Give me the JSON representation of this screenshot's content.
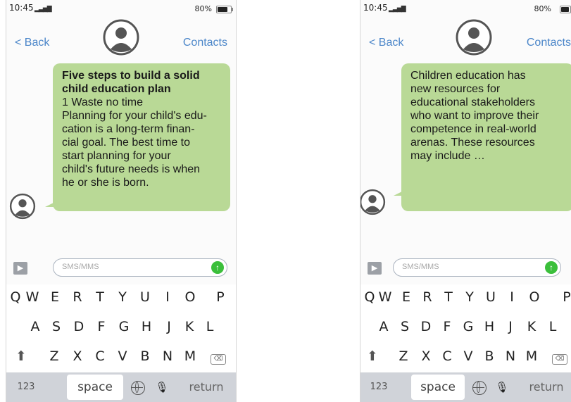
{
  "screens": [
    {
      "status": {
        "time": "10:45",
        "signal": "▂▃▅▇",
        "battery": "80%"
      },
      "nav": {
        "back": "< Back",
        "contacts": "Contacts"
      },
      "message": {
        "title": "Five steps to build a solid child education plan",
        "lines": [
          "1 Waste no time",
          "Planning for your child's edu-",
          "cation is a long-term finan-",
          "cial goal. The best time to",
          "start planning for your",
          "child's future needs is when",
          "he or she is born."
        ]
      },
      "input": {
        "placeholder": "SMS/MMS",
        "send_icon": "↑",
        "expand_icon": "▶"
      }
    },
    {
      "status": {
        "time": "10:45",
        "signal": "▂▃▅▇",
        "battery": "80%"
      },
      "nav": {
        "back": "< Back",
        "contacts": "Contacts"
      },
      "message": {
        "lines": [
          "Children education has",
          "new resources for",
          "educational stakeholders",
          "who want to improve their",
          "competence in real-world",
          "arenas. These resources",
          "may include …"
        ]
      },
      "input": {
        "placeholder": "SMS/MMS",
        "send_icon": "↑",
        "expand_icon": "▶"
      }
    }
  ],
  "keyboard": {
    "row1": [
      "Q",
      "W",
      "E",
      "R",
      "T",
      "Y",
      "U",
      "I",
      "O",
      "P"
    ],
    "row2": [
      "A",
      "S",
      "D",
      "F",
      "G",
      "H",
      "J",
      "K",
      "L"
    ],
    "row3": [
      "Z",
      "X",
      "C",
      "V",
      "B",
      "N",
      "M"
    ],
    "shift_icon": "⬆",
    "backspace_icon": "⌫",
    "numbers": "123",
    "space": "space",
    "return": "return",
    "mic_icon": "🎙"
  },
  "colors": {
    "bubble": "#b9d996",
    "accent": "#4b86c9",
    "send": "#3bbf3b",
    "keyboard_bar": "#d0d3d9"
  }
}
